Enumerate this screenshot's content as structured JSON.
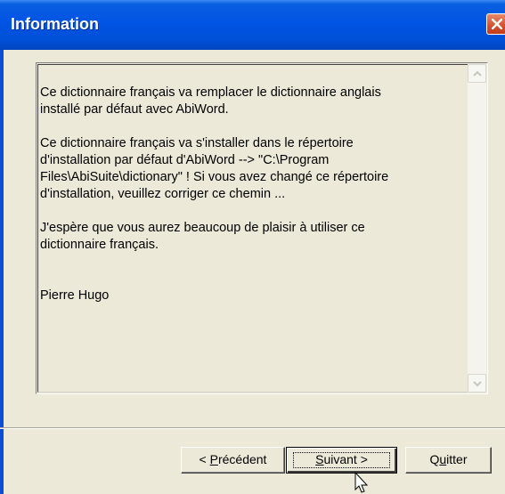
{
  "window": {
    "title": "Information"
  },
  "message": {
    "paragraphs": [
      "Ce dictionnaire français va remplacer le dictionnaire anglais\ninstallé par défaut avec AbiWord.",
      "Ce dictionnaire français va s'installer dans le répertoire\nd'installation par défaut d'AbiWord --> \"C:\\Program\nFiles\\AbiSuite\\dictionary\" ! Si vous avez changé ce répertoire\nd'installation, veuillez corriger ce chemin ...",
      "J'espère que vous aurez beaucoup de plaisir à utiliser ce\ndictionnaire français.",
      "Pierre Hugo"
    ]
  },
  "buttons": {
    "prev_prefix": "< ",
    "prev_mnemonic": "P",
    "prev_rest": "récédent",
    "next_mnemonic": "S",
    "next_rest": "uivant >",
    "quit_prefix": "Q",
    "quit_mnemonic": "u",
    "quit_rest": "itter"
  }
}
